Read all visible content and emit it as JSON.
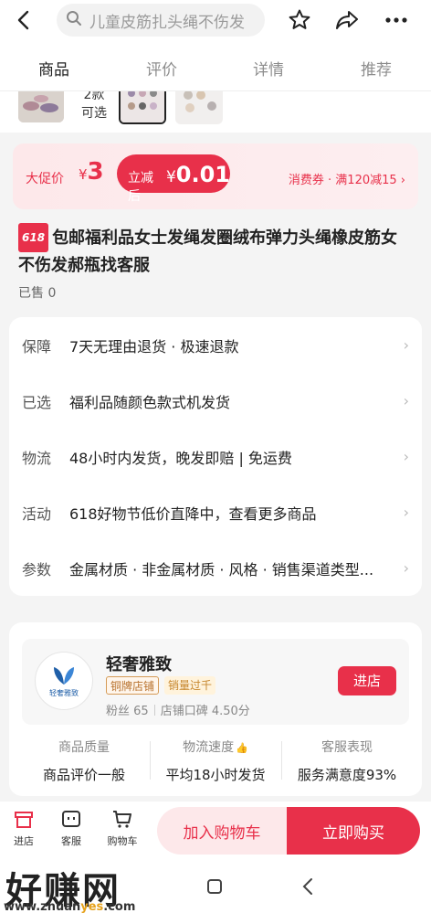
{
  "search": {
    "placeholder": "儿童皮筋扎头绳不伤发"
  },
  "tabs": [
    {
      "label": "商品",
      "active": true
    },
    {
      "label": "评价",
      "active": false
    },
    {
      "label": "详情",
      "active": false
    },
    {
      "label": "推荐",
      "active": false
    }
  ],
  "variants": {
    "count_label": "2款\n可选"
  },
  "promo": {
    "label": "大促价",
    "price_symbol": "¥",
    "price": "3",
    "after_label": "立减后",
    "after_symbol": "¥",
    "after_price": "0.01",
    "coupon": "消费券 · 满120减15 ›"
  },
  "product": {
    "tag": "618",
    "title": "包邮福利品女士发绳发圈绒布弹力头绳橡皮筋女不伤发郝瓶找客服",
    "sold": "已售 0"
  },
  "info": [
    {
      "key": "保障",
      "value": "7天无理由退货 · 极速退款"
    },
    {
      "key": "已选",
      "value": "福利品随颜色款式机发货"
    },
    {
      "key": "物流",
      "value": "48小时内发货，晚发即赔 | 免运费"
    },
    {
      "key": "活动",
      "value": "618好物节低价直降中，查看更多商品"
    },
    {
      "key": "参数",
      "value": "金属材质 · 非金属材质 · 风格 · 销售渠道类型..."
    }
  ],
  "shop": {
    "logo_text": "轻奢雅致",
    "name": "轻奢雅致",
    "badge1": "铜牌店铺",
    "badge2": "销量过千",
    "fans": "粉丝 65",
    "rating": "店铺口碑 4.50分",
    "enter": "进店",
    "stats": [
      {
        "key": "商品质量",
        "value": "商品评价一般"
      },
      {
        "key": "物流速度",
        "value": "平均18小时发货"
      },
      {
        "key": "客服表现",
        "value": "服务满意度93%"
      }
    ]
  },
  "bottom": {
    "store": "进店",
    "service": "客服",
    "cart": "购物车",
    "add_cart": "加入购物车",
    "buy_now": "立即购买"
  },
  "watermark": {
    "text": "好赚网",
    "url_a": "www.zhuan",
    "url_b": "yes",
    "url_c": ".com"
  },
  "colors": {
    "accent": "#e8304a",
    "promo_bg": "#fde8ea"
  }
}
